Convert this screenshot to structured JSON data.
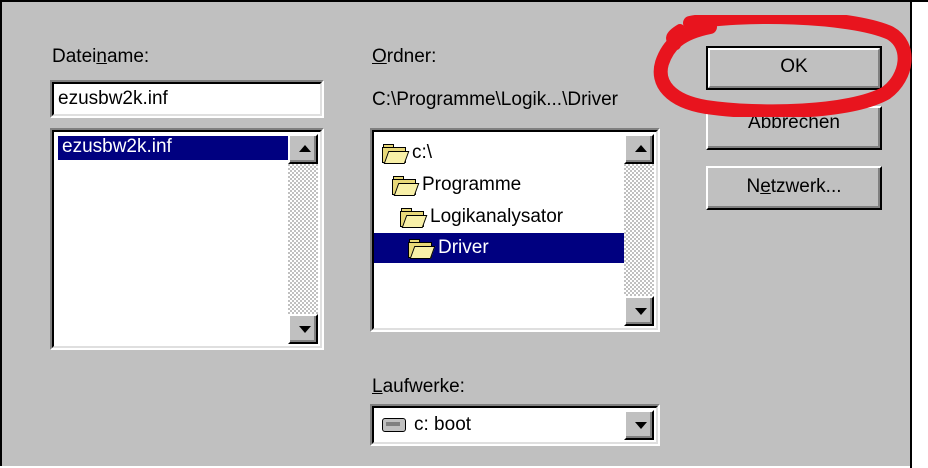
{
  "file_name": {
    "label_pre": "Datei",
    "label_ul": "n",
    "label_post": "ame:",
    "value": "ezusbw2k.inf",
    "list": [
      "ezusbw2k.inf"
    ]
  },
  "folders": {
    "label_ul": "O",
    "label_post": "rdner:",
    "current_path": "C:\\Programme\\Logik...\\Driver",
    "tree": [
      "c:\\",
      "Programme",
      "Logikanalysator",
      "Driver"
    ]
  },
  "drives": {
    "label_ul": "L",
    "label_post": "aufwerke:",
    "selected": "c: boot"
  },
  "buttons": {
    "ok": "OK",
    "cancel": "Abbrechen",
    "network_pre": "N",
    "network_ul": "e",
    "network_post": "tzwerk..."
  },
  "colors": {
    "dialog_bg": "#c0c0c0",
    "selection": "#000080",
    "annotation_red": "#e8141e"
  }
}
